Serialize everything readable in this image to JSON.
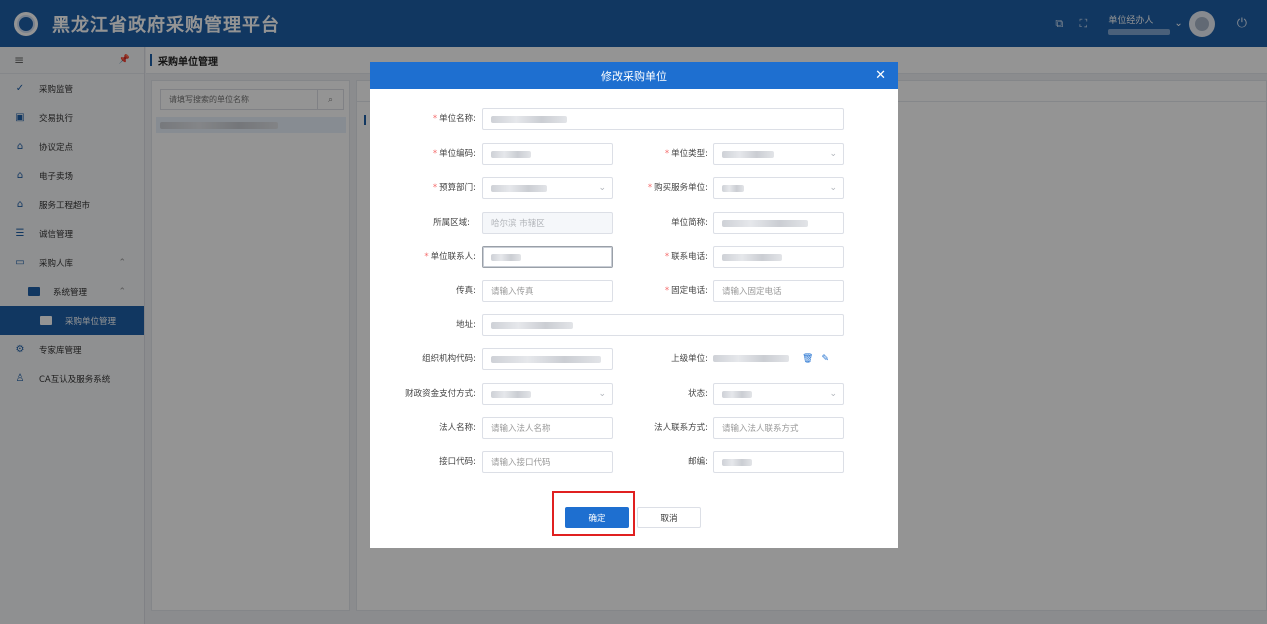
{
  "header": {
    "title": "黑龙江省政府采购管理平台",
    "user_role": "单位经办人"
  },
  "sidebar": {
    "items": [
      {
        "label": "采购监管",
        "icon": "shield-check-icon"
      },
      {
        "label": "交易执行",
        "icon": "clipboard-icon"
      },
      {
        "label": "协议定点",
        "icon": "store-icon"
      },
      {
        "label": "电子卖场",
        "icon": "store-icon"
      },
      {
        "label": "服务工程超市",
        "icon": "store-icon"
      },
      {
        "label": "诚信管理",
        "icon": "list-icon"
      },
      {
        "label": "采购人库",
        "icon": "folder-icon"
      },
      {
        "label": "系统管理",
        "icon": "monitor-icon"
      },
      {
        "label": "采购单位管理",
        "icon": "monitor-icon"
      },
      {
        "label": "专家库管理",
        "icon": "gear-icon"
      },
      {
        "label": "CA互认及服务系统",
        "icon": "person-icon"
      }
    ]
  },
  "breadcrumb": {
    "current": "采购单位管理"
  },
  "left_panel": {
    "search_placeholder": "请填写搜索的单位名称"
  },
  "modal": {
    "title": "修改采购单位",
    "fields": {
      "unit_name": "单位名称:",
      "unit_code": "单位编码:",
      "unit_type": "单位类型:",
      "budget_dept": "预算部门:",
      "purchase_service_unit": "购买服务单位:",
      "region": "所属区域:",
      "region_value": "哈尔滨 市辖区",
      "short_name": "单位简称:",
      "contact": "单位联系人:",
      "phone": "联系电话:",
      "fax": "传真:",
      "fax_placeholder": "请输入传真",
      "landline": "固定电话:",
      "landline_placeholder": "请输入固定电话",
      "address": "地址:",
      "org_code": "组织机构代码:",
      "parent_unit": "上级单位:",
      "payment_method": "财政资金支付方式:",
      "status": "状态:",
      "legal_name": "法人名称:",
      "legal_name_placeholder": "请输入法人名称",
      "legal_contact": "法人联系方式:",
      "legal_contact_placeholder": "请输入法人联系方式",
      "interface_code": "接口代码:",
      "interface_code_placeholder": "请输入接口代码",
      "postcode": "邮编:"
    },
    "confirm_label": "确定",
    "cancel_label": "取消"
  }
}
